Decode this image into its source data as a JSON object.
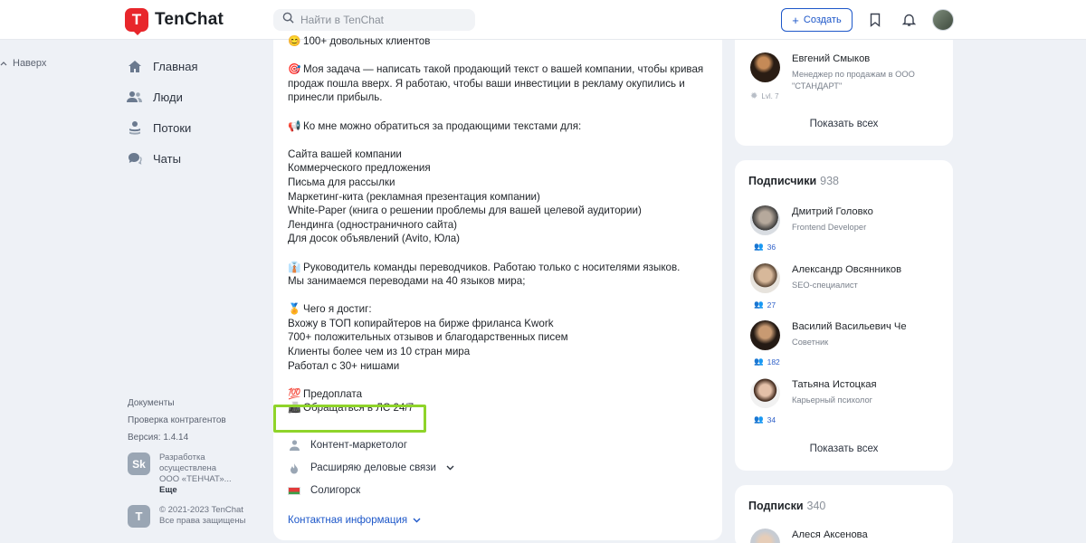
{
  "header": {
    "brand": "TenChat",
    "search_placeholder": "Найти в TenChat",
    "create_label": "Создать"
  },
  "sidebar": {
    "back_label": "Наверх",
    "items": [
      {
        "label": "Главная",
        "icon": "home-icon"
      },
      {
        "label": "Люди",
        "icon": "people-icon"
      },
      {
        "label": "Потоки",
        "icon": "streams-icon"
      },
      {
        "label": "Чаты",
        "icon": "chats-icon"
      }
    ],
    "links": [
      "Документы",
      "Проверка контрагентов",
      "Версия: 1.4.14"
    ],
    "dev_logo": "Sk",
    "dev_line1": "Разработка",
    "dev_line2": "осуществлена",
    "dev_line3": "ООО «ТЕНЧАТ»...",
    "dev_more": "Еще",
    "copyright_line1": "© 2021-2023 TenChat",
    "copyright_line2": "Все права защищены"
  },
  "post": {
    "lines": [
      {
        "emoji": "😊",
        "text": "100+ довольных клиентов"
      },
      {
        "emoji": "",
        "text": ""
      },
      {
        "emoji": "🎯",
        "text": "Моя задача — написать такой продающий текст о вашей компании, чтобы кривая"
      },
      {
        "emoji": "",
        "text": "продаж пошла вверх. Я работаю, чтобы ваши инвестиции в рекламу окупились и"
      },
      {
        "emoji": "",
        "text": "принесли прибыль."
      },
      {
        "emoji": "",
        "text": ""
      },
      {
        "emoji": "📢",
        "text": "Ко мне можно обратиться за продающими текстами для:"
      },
      {
        "emoji": "",
        "text": ""
      },
      {
        "emoji": "",
        "text": "Сайта вашей компании"
      },
      {
        "emoji": "",
        "text": "Коммерческого предложения"
      },
      {
        "emoji": "",
        "text": "Письма для рассылки"
      },
      {
        "emoji": "",
        "text": "Маркетинг-кита (рекламная презентация компании)"
      },
      {
        "emoji": "",
        "text": "White-Paper (книга о решении проблемы для вашей целевой аудитории)"
      },
      {
        "emoji": "",
        "text": "Лендинга (одностраничного сайта)"
      },
      {
        "emoji": "",
        "text": "Для досок объявлений (Avito, Юла)"
      },
      {
        "emoji": "",
        "text": ""
      },
      {
        "emoji": "👔",
        "text": "Руководитель команды переводчиков. Работаю только с носителями языков."
      },
      {
        "emoji": "",
        "text": "Мы занимаемся переводами на 40 языков мира;"
      },
      {
        "emoji": "",
        "text": ""
      },
      {
        "emoji": "🏅",
        "text": "Чего я достиг:"
      },
      {
        "emoji": "",
        "text": "Вхожу в ТОП копирайтеров на бирже фриланса Kwork"
      },
      {
        "emoji": "",
        "text": "700+ положительных отзывов и благодарственных писем"
      },
      {
        "emoji": "",
        "text": "Клиенты более чем из 10 стран мира"
      },
      {
        "emoji": "",
        "text": "Работал с 30+ нишами"
      },
      {
        "emoji": "",
        "text": ""
      },
      {
        "emoji": "💯",
        "text": "Предоплата"
      },
      {
        "emoji": "📠",
        "text": "Обращаться в ЛС 24/7"
      }
    ],
    "profession": "Контент-маркетолог",
    "goal": "Расширяю деловые связи",
    "city": "Солигорск",
    "contact_label": "Контактная информация"
  },
  "right": {
    "top_person": {
      "name": "Евгений Смыков",
      "role": "Менеджер по продажам в ООО \"СТАНДАРТ\"",
      "level": "Lvl. 7"
    },
    "show_all_1": "Показать всех",
    "subscribers_title": "Подписчики",
    "subscribers_count": "938",
    "subscribers": [
      {
        "name": "Дмитрий Головко",
        "role": "Frontend Developer",
        "count": "36"
      },
      {
        "name": "Александр Овсянников",
        "role": "SEO-специалист",
        "count": "27"
      },
      {
        "name": "Василий Васильевич Че",
        "role": "Советник",
        "count": "182"
      },
      {
        "name": "Татьяна Истоцкая",
        "role": "Карьерный психолог",
        "count": "34"
      }
    ],
    "show_all_2": "Показать всех",
    "subscriptions_title": "Подписки",
    "subscriptions_count": "340",
    "subscriptions": [
      {
        "name": "Алеся Аксенова"
      }
    ]
  },
  "colors": {
    "accent": "#1d57c9",
    "brand": "#e8262b",
    "highlight": "#8fd42a"
  }
}
